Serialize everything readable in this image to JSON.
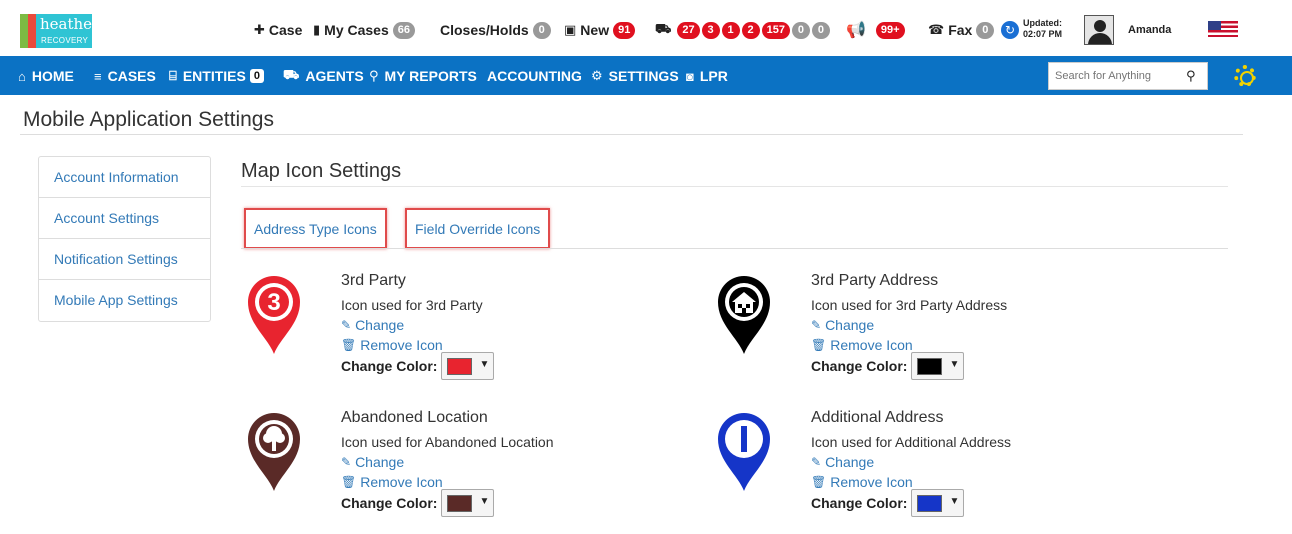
{
  "logo": {
    "word1": "heather",
    "word2": "RECOVERY"
  },
  "topbar": {
    "case": {
      "label": "Case",
      "icon": "plus-icon"
    },
    "my_cases": {
      "label": "My Cases",
      "count": "66",
      "icon": "briefcase-icon"
    },
    "closes_holds": {
      "label": "Closes/Holds",
      "count": "0"
    },
    "new": {
      "label": "New",
      "count": "91",
      "icon": "toolbox-icon"
    },
    "trucks": {
      "icon": "truck-icon",
      "counts": [
        "27",
        "3",
        "1",
        "2",
        "157",
        "0",
        "0"
      ]
    },
    "announcements": {
      "icon": "megaphone-icon",
      "count": "99+"
    },
    "fax": {
      "label": "Fax",
      "count": "0",
      "icon": "fax-icon"
    },
    "updated": {
      "label": "Updated:",
      "time": "02:07 PM"
    },
    "user": {
      "name": "Amanda"
    }
  },
  "nav": {
    "home": "HOME",
    "cases": "CASES",
    "entities": "ENTITIES",
    "entities_count": "0",
    "agents": "AGENTS",
    "my_reports": "MY REPORTS",
    "accounting": "ACCOUNTING",
    "settings": "SETTINGS",
    "lpr": "LPR",
    "search_placeholder": "Search for Anything"
  },
  "page": {
    "title": "Mobile Application Settings",
    "sidenav": [
      "Account Information",
      "Account Settings",
      "Notification Settings",
      "Mobile App Settings"
    ],
    "section_title": "Map Icon Settings",
    "tabs": [
      "Address Type Icons",
      "Field Override Icons"
    ],
    "change_label": "Change",
    "remove_label": "Remove Icon",
    "color_label": "Change Color:",
    "icons": [
      {
        "name": "3rd Party",
        "description": "Icon used for 3rd Party",
        "color": "#e8242f",
        "glyph": "3"
      },
      {
        "name": "3rd Party Address",
        "description": "Icon used for 3rd Party Address",
        "color": "#000000",
        "glyph": "house"
      },
      {
        "name": "Abandoned Location",
        "description": "Icon used for Abandoned Location",
        "color": "#5a2a27",
        "glyph": "tree"
      },
      {
        "name": "Additional Address",
        "description": "Icon used for Additional Address",
        "color": "#1535c8",
        "glyph": "I"
      }
    ]
  }
}
